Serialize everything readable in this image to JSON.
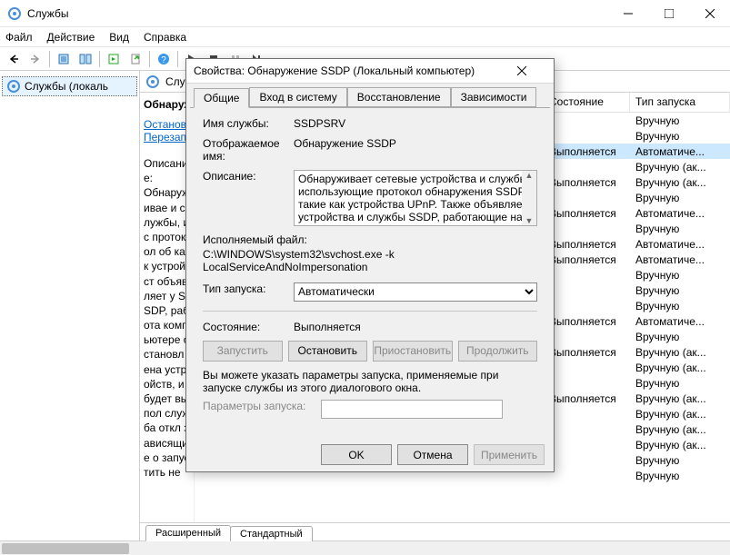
{
  "window": {
    "title": "Службы",
    "menu": [
      "Файл",
      "Действие",
      "Вид",
      "Справка"
    ]
  },
  "tree": {
    "node": "Службы (локаль"
  },
  "panel_header": "Службы",
  "detail": {
    "name": "Обнаружени",
    "link_stop": "Остановить",
    "link_restart": "Перезапусти",
    "desc_label": "Описание:",
    "desc_text": "Обнаруживае и службы, иc протокол об как устройст объявляет у SSDP, работа компьютере остановлена устройств, и будет выпол служба откл зависящие о запустить не"
  },
  "columns": {
    "state": "Состояние",
    "start": "Тип запуска"
  },
  "rows": [
    {
      "state": "",
      "start": "Вручную"
    },
    {
      "state": "",
      "start": "Вручную"
    },
    {
      "state": "Выполняется",
      "start": "Автоматиче...",
      "selected": true
    },
    {
      "state": "",
      "start": "Вручную (ак..."
    },
    {
      "state": "Выполняется",
      "start": "Вручную (ак..."
    },
    {
      "state": "",
      "start": "Вручную"
    },
    {
      "state": "Выполняется",
      "start": "Автоматиче..."
    },
    {
      "state": "",
      "start": "Вручную"
    },
    {
      "state": "Выполняется",
      "start": "Автоматиче..."
    },
    {
      "state": "Выполняется",
      "start": "Автоматиче..."
    },
    {
      "state": "",
      "start": "Вручную"
    },
    {
      "state": "",
      "start": "Вручную"
    },
    {
      "state": "",
      "start": "Вручную"
    },
    {
      "state": "Выполняется",
      "start": "Автоматиче..."
    },
    {
      "state": "",
      "start": "Вручную"
    },
    {
      "state": "Выполняется",
      "start": "Вручную (ак..."
    },
    {
      "state": "",
      "start": "Вручную (ак..."
    },
    {
      "state": "",
      "start": "Вручную"
    },
    {
      "state": "Выполняется",
      "start": "Вручную (ак..."
    },
    {
      "state": "",
      "start": "Вручную (ак..."
    },
    {
      "state": "",
      "start": "Вручную (ак..."
    },
    {
      "state": "",
      "start": "Вручную (ак..."
    },
    {
      "state": "",
      "start": "Вручную"
    },
    {
      "state": "",
      "start": "Вручную"
    }
  ],
  "bottom_tabs": {
    "extended": "Расширенный",
    "standard": "Стандартный"
  },
  "dialog": {
    "title": "Свойства: Обнаружение SSDP (Локальный компьютер)",
    "tabs": [
      "Общие",
      "Вход в систему",
      "Восстановление",
      "Зависимости"
    ],
    "labels": {
      "svc_name": "Имя службы:",
      "disp_name": "Отображаемое имя:",
      "desc": "Описание:",
      "exe": "Исполняемый файл:",
      "startup": "Тип запуска:",
      "state": "Состояние:",
      "param_hint": "Вы можете указать параметры запуска, применяемые при запуске службы из этого диалогового окна.",
      "params": "Параметры запуска:"
    },
    "values": {
      "svc_name": "SSDPSRV",
      "disp_name": "Обнаружение SSDP",
      "desc": "Обнаруживает сетевые устройства и службы, использующие протокол обнаружения SSDP, такие как устройства UPnP. Также объявляет устройства и службы SSDP, работающие на",
      "exe": "C:\\WINDOWS\\system32\\svchost.exe -k LocalServiceAndNoImpersonation",
      "startup": "Автоматически",
      "state": "Выполняется"
    },
    "buttons": {
      "start": "Запустить",
      "stop": "Остановить",
      "pause": "Приостановить",
      "resume": "Продолжить",
      "ok": "OK",
      "cancel": "Отмена",
      "apply": "Применить"
    }
  }
}
